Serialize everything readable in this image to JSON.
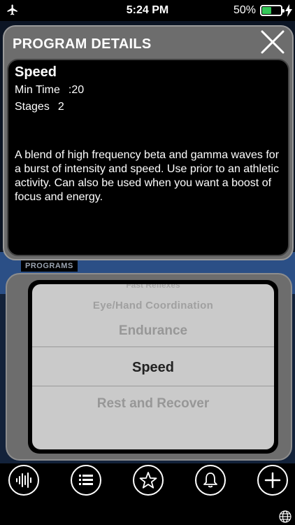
{
  "status": {
    "time": "5:24 PM",
    "battery_percent": "50%",
    "battery_level": 0.5,
    "icons": [
      "airplane-icon",
      "battery-icon",
      "charging-bolt-icon"
    ],
    "battery_color": "#35c759"
  },
  "details": {
    "header_title": "PROGRAM DETAILS",
    "program_name": "Speed",
    "min_time_label": "Min Time",
    "min_time_value": ":20",
    "stages_label": "Stages",
    "stages_value": "2",
    "description": "A blend of high frequency beta and gamma waves for a burst of intensity and speed.  Use prior to an athletic activity.  Can also be used when you want a boost of focus and energy."
  },
  "programs": {
    "section_label": "PROGRAMS",
    "items": [
      "Fast Reflexes",
      "Eye/Hand Coordination",
      "Endurance",
      "Speed",
      "Rest and Recover"
    ],
    "selected": "Speed"
  },
  "toolbar": {
    "buttons": [
      "waveform-icon",
      "list-icon",
      "star-icon",
      "bell-icon",
      "plus-icon"
    ]
  },
  "colors": {
    "panel_gray": "#6d6d6d",
    "picker_bg": "#cacaca",
    "accent_blue": "#2b4f86"
  }
}
